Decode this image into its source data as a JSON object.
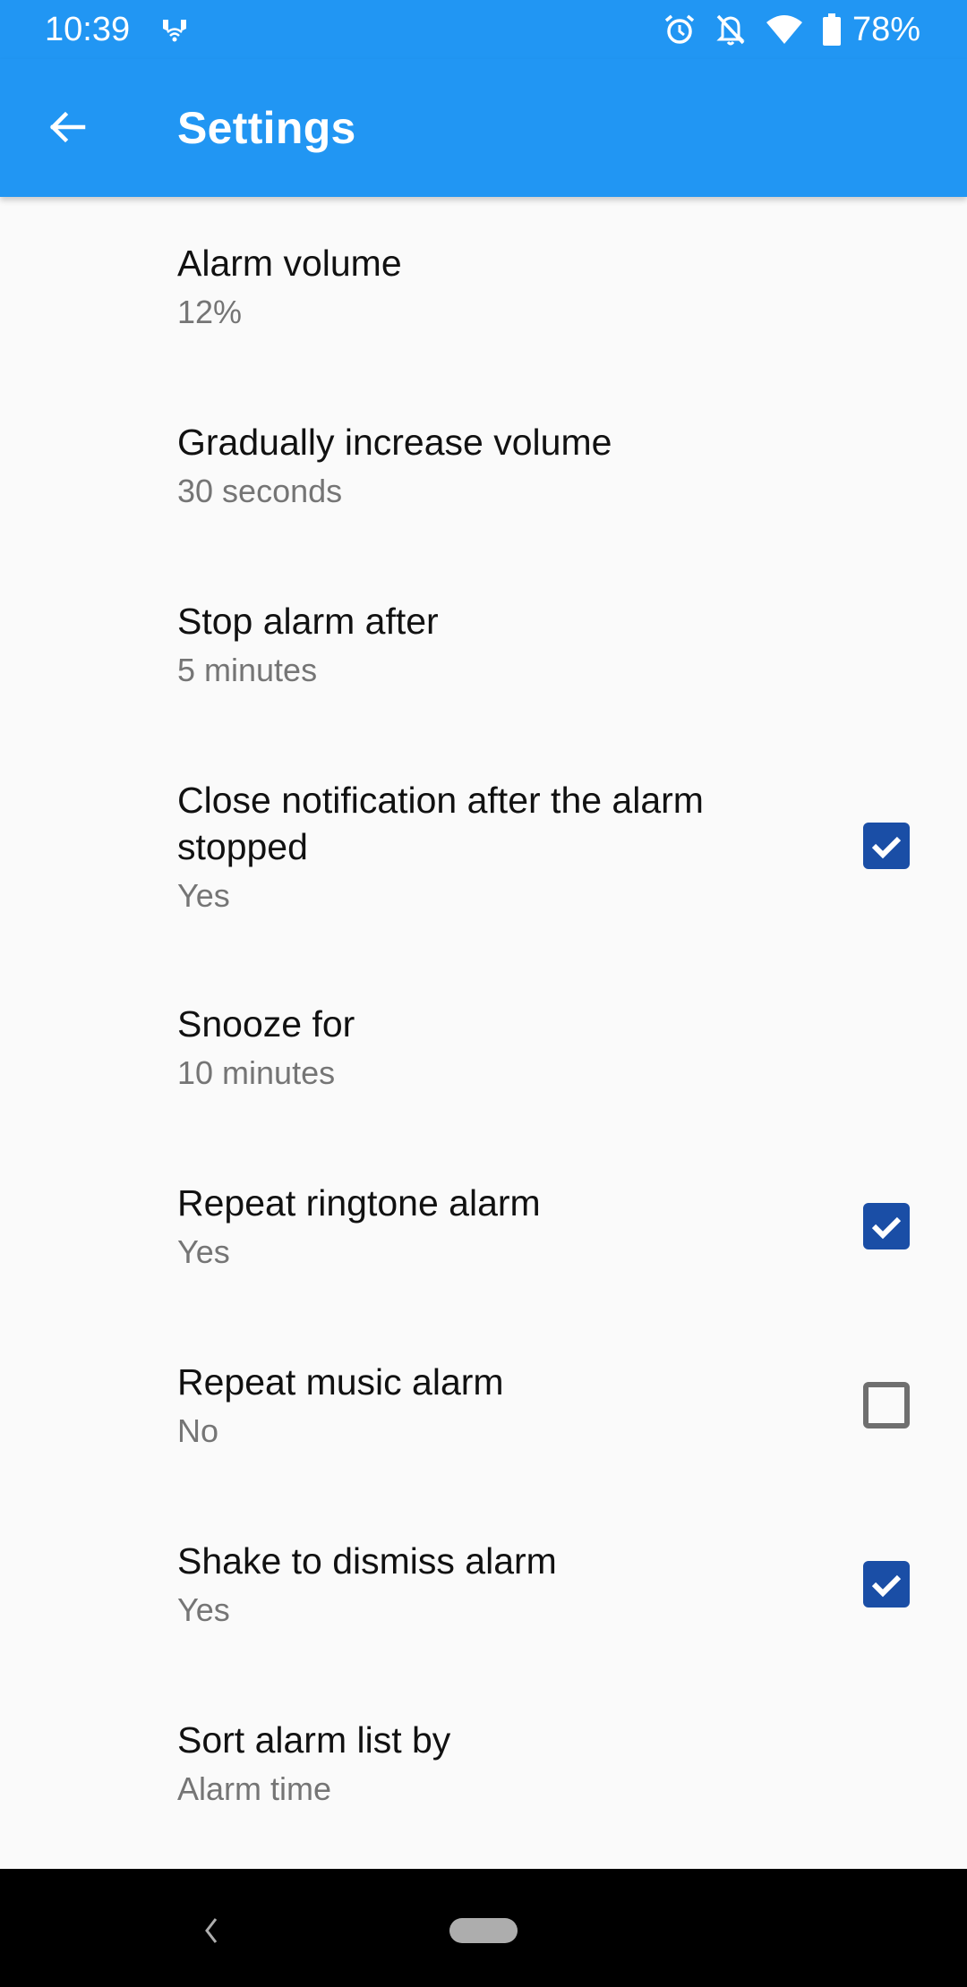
{
  "status_bar": {
    "time": "10:39",
    "left_icons": [
      "hotspot-icon"
    ],
    "right_icons": [
      "alarm-clock-icon",
      "notifications-off-icon",
      "wifi-icon",
      "battery-icon"
    ],
    "battery_percent": "78%"
  },
  "app_bar": {
    "back_icon": "arrow-back-icon",
    "title": "Settings"
  },
  "colors": {
    "primary": "#2196f3",
    "checkbox_checked": "#1a4ea6",
    "checkbox_unchecked": "#6f6f6f",
    "background": "#fafafa",
    "summary_text": "#757575"
  },
  "settings": [
    {
      "title": "Alarm volume",
      "summary": "12%",
      "checkbox": null
    },
    {
      "title": "Gradually increase volume",
      "summary": "30 seconds",
      "checkbox": null
    },
    {
      "title": "Stop alarm after",
      "summary": "5 minutes",
      "checkbox": null
    },
    {
      "title": "Close notification after the alarm stopped",
      "summary": "Yes",
      "checkbox": true
    },
    {
      "title": "Snooze for",
      "summary": "10 minutes",
      "checkbox": null
    },
    {
      "title": "Repeat ringtone alarm",
      "summary": "Yes",
      "checkbox": true
    },
    {
      "title": "Repeat music alarm",
      "summary": "No",
      "checkbox": false
    },
    {
      "title": "Shake to dismiss alarm",
      "summary": "Yes",
      "checkbox": true
    },
    {
      "title": "Sort alarm list by",
      "summary": "Alarm time",
      "checkbox": null
    }
  ],
  "nav_bar": {
    "back_icon": "nav-back-icon",
    "home_icon": "home-pill-icon"
  }
}
